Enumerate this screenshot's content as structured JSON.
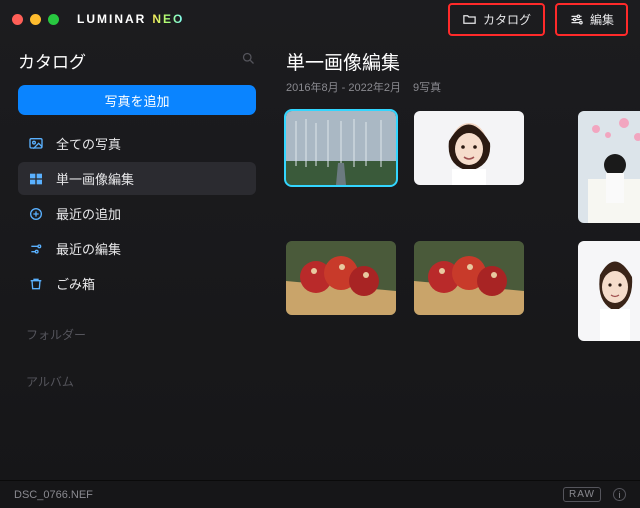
{
  "brand": {
    "name": "LUMINAR",
    "sub": "NEO"
  },
  "top": {
    "catalog": "カタログ",
    "edit": "編集"
  },
  "sidebar": {
    "title": "カタログ",
    "add_button": "写真を追加",
    "items": [
      {
        "label": "全ての写真"
      },
      {
        "label": "単一画像編集"
      },
      {
        "label": "最近の追加"
      },
      {
        "label": "最近の編集"
      },
      {
        "label": "ごみ箱"
      }
    ],
    "sections": {
      "folders": "フォルダー",
      "albums": "アルバム"
    }
  },
  "main": {
    "title": "単一画像編集",
    "date_range": "2016年8月 - 2022年2月",
    "count": "9写真"
  },
  "status": {
    "filename": "DSC_0766.NEF",
    "raw": "RAW"
  }
}
